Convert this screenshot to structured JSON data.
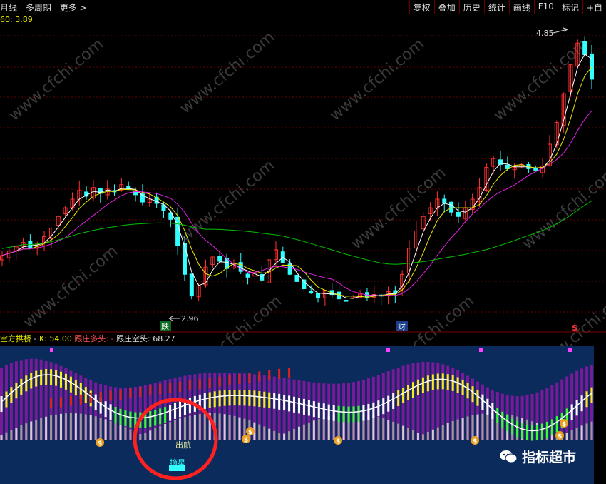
{
  "toolbar": {
    "left_items": [
      "月线",
      "多周期",
      "更多 >"
    ],
    "right_buttons": [
      "复权",
      "叠加",
      "历史",
      "统计",
      "画线",
      "F10",
      "标记",
      "+自"
    ]
  },
  "ma_label": "60: 3.89",
  "price_panel": {
    "high_label": "4.85",
    "low_label": "2.96",
    "signals": {
      "die": "跌",
      "cai": "财"
    }
  },
  "oscillator": {
    "name": "空方拱桥",
    "k_label": "K: 54.00",
    "follow_long_label": "跟庄多头: -",
    "follow_short_label": "跟庄空头: 68.27",
    "signals": {
      "chuhang": "出航",
      "zhaixing": "摘星"
    }
  },
  "watermark": "www.cfchi.com",
  "brand": {
    "text": "指标超市"
  },
  "colors": {
    "up": "#ff3030",
    "down": "#33ffff",
    "ma_short": "#ffffff",
    "ma_mid": "#e8e800",
    "ma_long": "#e020e0",
    "ma_slow": "#00c000",
    "panel_bg": "#0a2b5c",
    "circle": "#ff2020"
  },
  "chart_data": {
    "type": "candlestick",
    "price_range": [
      2.9,
      4.9
    ],
    "price_high": 4.85,
    "price_low": 2.96,
    "close_path": [
      3.33,
      3.36,
      3.39,
      3.42,
      3.38,
      3.41,
      3.46,
      3.52,
      3.6,
      3.66,
      3.72,
      3.78,
      3.74,
      3.8,
      3.76,
      3.79,
      3.77,
      3.82,
      3.79,
      3.75,
      3.7,
      3.72,
      3.69,
      3.64,
      3.58,
      3.4,
      3.2,
      3.05,
      3.12,
      3.25,
      3.32,
      3.29,
      3.24,
      3.27,
      3.22,
      3.18,
      3.21,
      3.16,
      3.3,
      3.37,
      3.28,
      3.2,
      3.15,
      3.1,
      3.07,
      3.04,
      3.09,
      3.06,
      3.03,
      3.02,
      3.05,
      3.07,
      3.04,
      3.06,
      3.05,
      3.08,
      3.07,
      3.2,
      3.38,
      3.5,
      3.6,
      3.66,
      3.72,
      3.69,
      3.63,
      3.6,
      3.66,
      3.72,
      3.8,
      3.94,
      4.0,
      3.96,
      3.93,
      3.94,
      3.96,
      3.93,
      3.92,
      3.95,
      4.1,
      4.25,
      4.45,
      4.65,
      4.8,
      4.72,
      4.55
    ]
  }
}
